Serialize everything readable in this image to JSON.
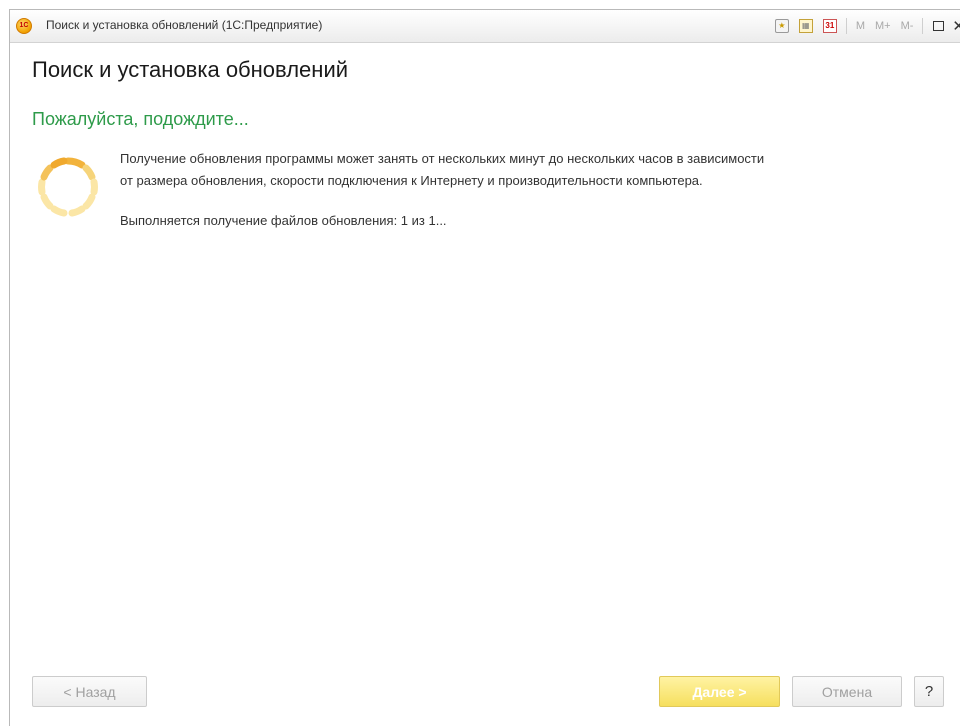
{
  "window": {
    "title": "Поиск и установка обновлений  (1С:Предприятие)",
    "toolbar": {
      "mem_m": "M",
      "mem_plus": "M+",
      "mem_minus": "M-",
      "calendar_day": "31"
    }
  },
  "form": {
    "title": "Поиск и установка обновлений",
    "wait_message": "Пожалуйста, подождите...",
    "info_line1": "Получение обновления программы может занять от нескольких минут до нескольких часов в зависимости",
    "info_line2": "от размера обновления, скорости подключения к Интернету и производительности компьютера.",
    "status": "Выполняется получение файлов обновления: 1 из 1..."
  },
  "buttons": {
    "back": "< Назад",
    "next": "Далее >",
    "cancel": "Отмена",
    "help": "?"
  },
  "colors": {
    "wait_text": "#2e9b4a",
    "next_button": "#f6df5e",
    "spinner": "#f7c84a"
  }
}
